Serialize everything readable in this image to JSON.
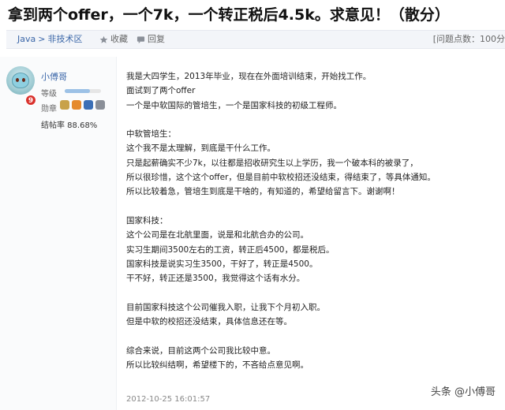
{
  "post": {
    "title": "拿到两个offer，一个7k，一个转正税后4.5k。求意见！（散分）"
  },
  "breadcrumb": {
    "section": "Java",
    "separator": ">",
    "subsection": "非技术区"
  },
  "actions": {
    "favorite_label": "收藏",
    "reply_label": "回复"
  },
  "points_text": "[问题点数：100分",
  "author": {
    "name": "小傅哥",
    "level_badge": "9",
    "grade_label": "等级",
    "grade_fill": 0.7,
    "medals_label": "勋章",
    "medal_colors": [
      "#c8a24a",
      "#e58a2e",
      "#3b6fb6",
      "#8a8f98"
    ],
    "close_rate": "结帖率 88.68%"
  },
  "content": {
    "lines": [
      "我是大四学生，2013年毕业，现在在外面培训结束，开始找工作。",
      "面试到了两个offer",
      "一个是中软国际的管培生，一个是国家科技的初级工程师。",
      "",
      "中软管培生：",
      "这个我不是太理解，到底是干什么工作。",
      "只是起薪确实不少7k，以往都是招收研究生以上学历，我一个破本科的被录了，",
      "所以很珍惜，这个这个offer，但是目前中软校招还没结束，得结束了，等具体通知。",
      "所以比较着急，管培生到底是干啥的，有知道的，希望给留言下。谢谢啊！",
      "",
      "国家科技：",
      "这个公司是在北航里面，说是和北航合办的公司。",
      "实习生期间3500左右的工资，转正后4500，都是税后。",
      "国家科技是说实习生3500，干好了，转正是4500。",
      "干不好，转正还是3500，我觉得这个话有水分。",
      "",
      "目前国家科技这个公司催我入职，让我下个月初入职。",
      "但是中软的校招还没结束，具体信息还在等。",
      "",
      "综合来说，目前这两个公司我比较中意。",
      "所以比较纠结啊，希望楼下的，不吝给点意见啊。"
    ],
    "timestamp": "2012-10-25 16:01:57"
  },
  "watermark": {
    "text": "头条 @小傅哥"
  }
}
